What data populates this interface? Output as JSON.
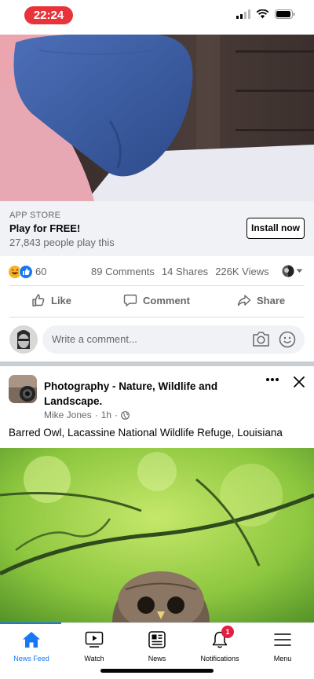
{
  "status_bar": {
    "time": "22:24"
  },
  "ad": {
    "source": "APP STORE",
    "title": "Play for FREE!",
    "subtitle": "27,843 people play this",
    "install_label": "Install now"
  },
  "reactions": {
    "count": "60",
    "comments": "89 Comments",
    "shares": "14 Shares",
    "views": "226K Views"
  },
  "actions": {
    "like": "Like",
    "comment": "Comment",
    "share": "Share"
  },
  "composer": {
    "placeholder": "Write a comment..."
  },
  "post": {
    "group_name": "Photography - Nature, Wildlife and Landscape.",
    "author": "Mike Jones",
    "time": "1h",
    "text": "Barred Owl, Lacassine National Wildlife Refuge, Louisiana"
  },
  "tabs": [
    {
      "label": "News Feed",
      "icon": "home-icon",
      "active": true
    },
    {
      "label": "Watch",
      "icon": "watch-icon"
    },
    {
      "label": "News",
      "icon": "news-icon"
    },
    {
      "label": "Notifications",
      "icon": "bell-icon",
      "badge": "1"
    },
    {
      "label": "Menu",
      "icon": "menu-icon"
    }
  ],
  "colors": {
    "accent": "#1877f2",
    "time_pill": "#e8333a",
    "badge": "#e41e3f"
  }
}
